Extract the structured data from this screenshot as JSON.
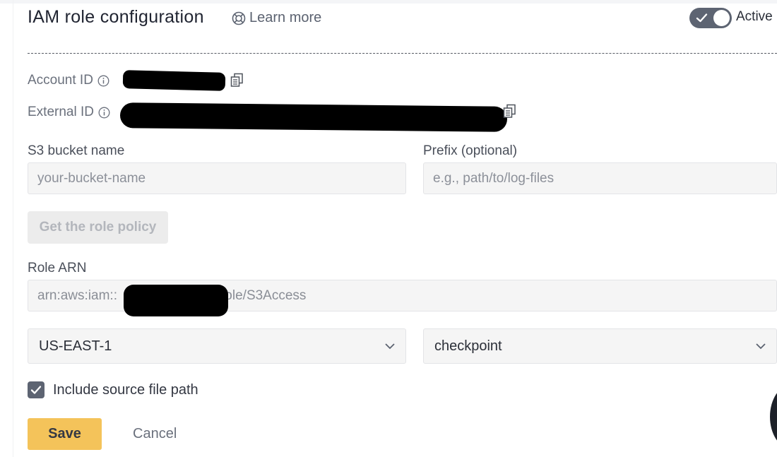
{
  "header": {
    "title": "IAM role configuration",
    "learn_more": "Learn more",
    "status_label": "Active",
    "status_on": true
  },
  "account": {
    "account_id_label": "Account ID",
    "external_id_label": "External ID"
  },
  "bucket": {
    "label": "S3 bucket name",
    "value": "",
    "placeholder": "your-bucket-name"
  },
  "prefix": {
    "label": "Prefix (optional)",
    "value": "",
    "placeholder": "e.g., path/to/log-files"
  },
  "policy_button": "Get the role policy",
  "role_arn": {
    "label": "Role ARN",
    "value_prefix": "arn:aws:iam::",
    "value_suffix": "role/S3Access"
  },
  "region_select": {
    "value": "US-EAST-1"
  },
  "format_select": {
    "value": "checkpoint"
  },
  "include_source": {
    "label": "Include source file path",
    "checked": true
  },
  "actions": {
    "save": "Save",
    "cancel": "Cancel"
  },
  "colors": {
    "accent": "#f4c35a",
    "toggle": "#5d6472"
  }
}
